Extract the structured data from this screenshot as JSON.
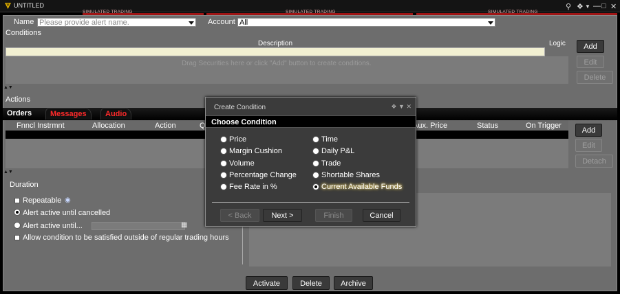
{
  "window": {
    "title": "UNTITLED",
    "sim_text": "SIMULATED TRADING"
  },
  "form": {
    "name_label": "Name",
    "name_placeholder": "Please provide alert name.",
    "account_label": "Account",
    "account_value": "All"
  },
  "conditions": {
    "section_label": "Conditions",
    "description_header": "Description",
    "logic_header": "Logic",
    "placeholder": "Drag Securities here or click \"Add\" button to create conditions.",
    "buttons": {
      "add": "Add",
      "edit": "Edit",
      "delete": "Delete"
    }
  },
  "actions": {
    "section_label": "Actions",
    "tabs": [
      "Orders",
      "Messages",
      "Audio"
    ],
    "columns": [
      "Fnncl Instrmnt",
      "Allocation",
      "Action",
      "Q",
      "Aux. Price",
      "Status",
      "On Trigger"
    ],
    "buttons": {
      "add": "Add",
      "edit": "Edit",
      "detach": "Detach"
    }
  },
  "duration": {
    "section_label": "Duration",
    "repeatable": "Repeatable",
    "until_cancelled": "Alert active until cancelled",
    "active_until": "Alert active until...",
    "outside_hours": "Allow condition to be satisfied outside of regular trading hours"
  },
  "bottom_buttons": {
    "activate": "Activate",
    "delete": "Delete",
    "archive": "Archive"
  },
  "dialog": {
    "title": "Create Condition",
    "header": "Choose Condition",
    "options_left": [
      "Price",
      "Margin Cushion",
      "Volume",
      "Percentage Change",
      "Fee Rate in %"
    ],
    "options_right": [
      "Time",
      "Daily P&L",
      "Trade",
      "Shortable Shares",
      "Current Available Funds"
    ],
    "selected": "Current Available Funds",
    "buttons": {
      "back": "< Back",
      "next": "Next >",
      "finish": "Finish",
      "cancel": "Cancel"
    }
  },
  "colors": {
    "panel": "#6d6d6d",
    "accent_red": "#a01515",
    "tab_messages": "#ff2a2a",
    "description_row": "#f2f0d2"
  }
}
